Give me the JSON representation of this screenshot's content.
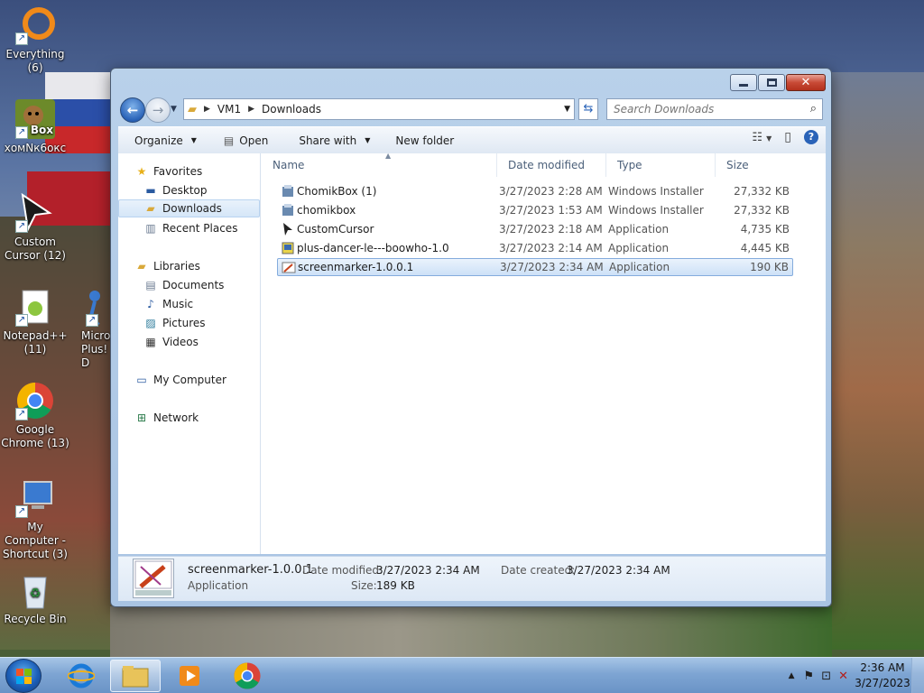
{
  "desktop": {
    "icons": [
      {
        "label": "Everything (6)",
        "icon": "everything-icon"
      },
      {
        "label": "хомNк6окс",
        "icon": "homikbox-icon"
      },
      {
        "label": "Custom Cursor (12)",
        "icon": "cursor-icon"
      },
      {
        "label": "Notepad++ (11)",
        "icon": "notepad-icon"
      },
      {
        "label": "Micro Plus! D",
        "icon": "dancer-icon"
      },
      {
        "label": "Google Chrome (13)",
        "icon": "chrome-icon"
      },
      {
        "label": "My Computer - Shortcut (3)",
        "icon": "computer-icon"
      },
      {
        "label": "Recycle Bin",
        "icon": "recycle-bin-icon"
      }
    ],
    "box_badge": "Box"
  },
  "explorer": {
    "address": {
      "crumbs": [
        "VM1",
        "Downloads"
      ]
    },
    "search": {
      "placeholder": "Search Downloads"
    },
    "toolbar": {
      "organize": "Organize",
      "open": "Open",
      "share_with": "Share with",
      "new_folder": "New folder"
    },
    "nav": {
      "favorites": "Favorites",
      "desktop": "Desktop",
      "downloads": "Downloads",
      "recent_places": "Recent Places",
      "libraries": "Libraries",
      "documents": "Documents",
      "music": "Music",
      "pictures": "Pictures",
      "videos": "Videos",
      "my_computer": "My Computer",
      "network": "Network"
    },
    "columns": {
      "name": "Name",
      "date": "Date modified",
      "type": "Type",
      "size": "Size"
    },
    "files": [
      {
        "name": "ChomikBox (1)",
        "date": "3/27/2023 2:28 AM",
        "type": "Windows Installer ...",
        "size": "27,332 KB"
      },
      {
        "name": "chomikbox",
        "date": "3/27/2023 1:53 AM",
        "type": "Windows Installer ...",
        "size": "27,332 KB"
      },
      {
        "name": "CustomCursor",
        "date": "3/27/2023 2:18 AM",
        "type": "Application",
        "size": "4,735 KB"
      },
      {
        "name": "plus-dancer-le---boowho-1.0",
        "date": "3/27/2023 2:14 AM",
        "type": "Application",
        "size": "4,445 KB"
      },
      {
        "name": "screenmarker-1.0.0.1",
        "date": "3/27/2023 2:34 AM",
        "type": "Application",
        "size": "190 KB"
      }
    ],
    "details": {
      "name": "screenmarker-1.0.0.1",
      "kind": "Application",
      "modified_label": "Date modified:",
      "modified_value": "3/27/2023 2:34 AM",
      "created_label": "Date created:",
      "created_value": "3/27/2023 2:34 AM",
      "size_label": "Size:",
      "size_value": "189 KB"
    }
  },
  "taskbar": {
    "clock_time": "2:36 AM",
    "clock_date": "3/27/2023"
  },
  "colors": {
    "selection": "#cde1f7",
    "taskbar": "#7ea5d3",
    "accent": "#2a63b8"
  }
}
